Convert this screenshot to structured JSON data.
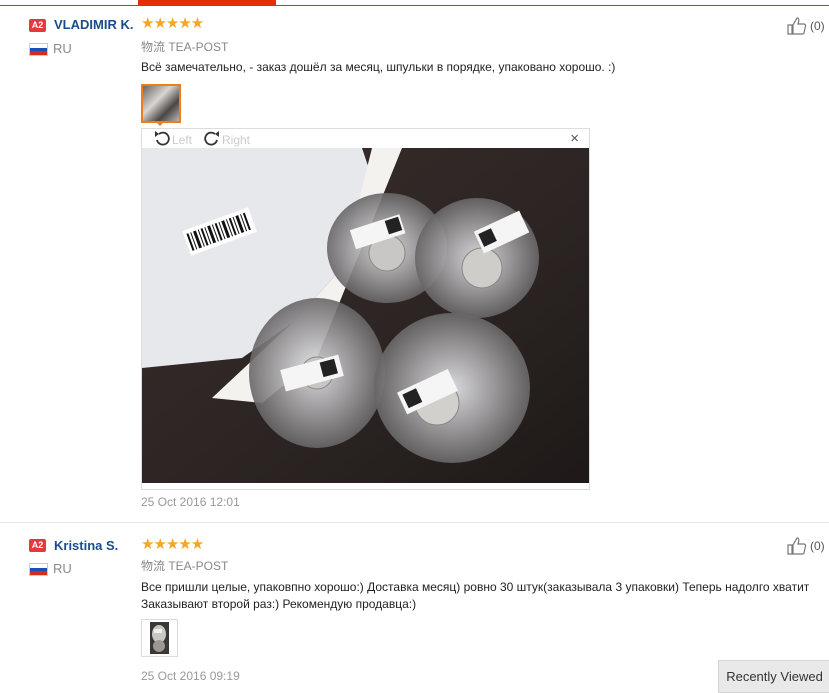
{
  "reviews": [
    {
      "badge": "A2",
      "name": "VLADIMIR K.",
      "country": "RU",
      "stars": "★★★★★",
      "logistics": "物流 TEA-POST",
      "text": "Всё замечательно, - заказ дошёл за месяц, шпульки в порядке, упаковано хорошо. :)",
      "likes": "(0)",
      "date": "25 Oct 2016 12:01",
      "viewer": {
        "left_label": "Left",
        "right_label": "Right",
        "close": "×"
      }
    },
    {
      "badge": "A2",
      "name": "Kristina S.",
      "country": "RU",
      "stars": "★★★★★",
      "logistics": "物流 TEA-POST",
      "text": "Все пришли целые, упаковпно хорошо:) Доставка месяц) ровно 30 штук(заказывала 3 упаковки) Теперь надолго хватит Заказывают второй раз:) Рекомендую продавца:)",
      "likes": "(0)",
      "date": "25 Oct 2016 09:19"
    }
  ],
  "recently_viewed": "Recently Viewed",
  "colors": {
    "accent": "#e62e04",
    "name": "#1a4c8d",
    "star": "#f5a623",
    "thumb_border": "#f07c1a"
  },
  "icons": [
    "thumbs-up-icon",
    "rotate-left-icon",
    "rotate-right-icon",
    "close-icon",
    "russia-flag-icon"
  ]
}
